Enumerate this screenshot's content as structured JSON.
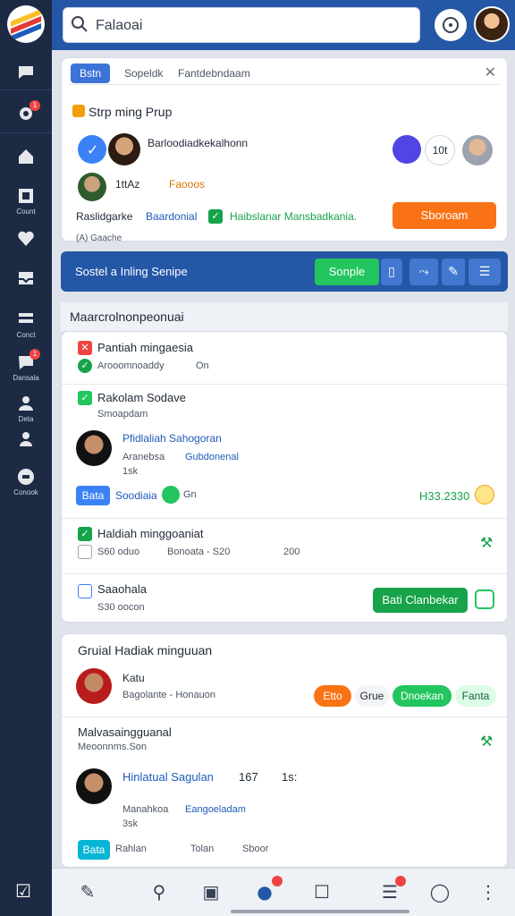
{
  "search": {
    "value": "Falaoai"
  },
  "colors": {
    "brand": "#2557a7",
    "accent_orange": "#f97316",
    "accent_green": "#16a34a",
    "sidebar": "#1c2a44"
  },
  "sidebar": {
    "items": [
      {
        "icon": "chat-icon",
        "label": ""
      },
      {
        "icon": "gear-icon",
        "label": "",
        "badge": "1"
      },
      {
        "icon": "home-icon",
        "label": ""
      },
      {
        "icon": "calendar-icon",
        "label": "Count"
      },
      {
        "icon": "heart-icon",
        "label": ""
      },
      {
        "icon": "inbox-icon",
        "label": ""
      },
      {
        "icon": "list-icon",
        "label": "Conct"
      },
      {
        "icon": "message-icon",
        "label": "Dansala",
        "badge": "1"
      },
      {
        "icon": "user-plus-icon",
        "label": "Deta"
      },
      {
        "icon": "person-icon",
        "label": ""
      },
      {
        "icon": "contact-icon",
        "label": "Conook"
      }
    ]
  },
  "group_card": {
    "tabs": [
      "Bstn",
      "Sopeldk",
      "Fantdebndaam"
    ],
    "title": "Strp ming Prup",
    "member1_name": "Barloodiadkekalhonn",
    "member2_name": "1ttAz",
    "member2_badge": "Faooos",
    "footer_left": "Raslidgarke",
    "footer_link": "Baardonial",
    "footer_status": "Haibslanar Mansbadkania.",
    "footer_button": "Sboroam",
    "mini_label": "10t",
    "partial_text": "(A) Gaache"
  },
  "bluebar": {
    "title": "Sostel a Inling Senipe",
    "button": "Sonple"
  },
  "section_title": "Maarcrolnonpeonuai",
  "list": {
    "item1": {
      "title": "Pantiah mingaesia",
      "sub": "Arooomnoaddy",
      "count": "On"
    },
    "item2": {
      "title": "Rakolam Sodave",
      "sub": "Smoapdam",
      "person_name": "Pfidlaliah Sahogoran",
      "person_role": "Aranebsa",
      "person_link": "Gubdonenal",
      "stat": "1sk",
      "tag": "Bata",
      "link": "Soodiaia",
      "reaction": "Gn",
      "value": "H33.2330"
    },
    "item3": {
      "title": "Haldiah minggoaniat",
      "sub": "S60 oduo",
      "sub2": "Bonoata - S20",
      "sub3": "200"
    },
    "item4": {
      "title": "Saaohala",
      "sub": "S30 oocon",
      "button": "Bati Clanbekar"
    }
  },
  "group2": {
    "title": "Gruial Hadiak minguuan",
    "person_name": "Katu",
    "person_role": "Bagolante - Honauon",
    "chips": [
      "Etto",
      "Grue",
      "Dnoekan",
      "Fanta"
    ],
    "sub_title": "Malvasaingguanal",
    "sub_sub": "Meoonnms.Son",
    "person2_name": "Hinlatual Sagulan",
    "person2_value": "167",
    "person2_value2": "1s:",
    "person2_role": "Manahkoa",
    "person2_link": "Eangoeladam",
    "person2_stat": "3sk",
    "tag": "Bata",
    "link": "Rahlan",
    "link2": "Tolan",
    "link3": "Sboor"
  }
}
